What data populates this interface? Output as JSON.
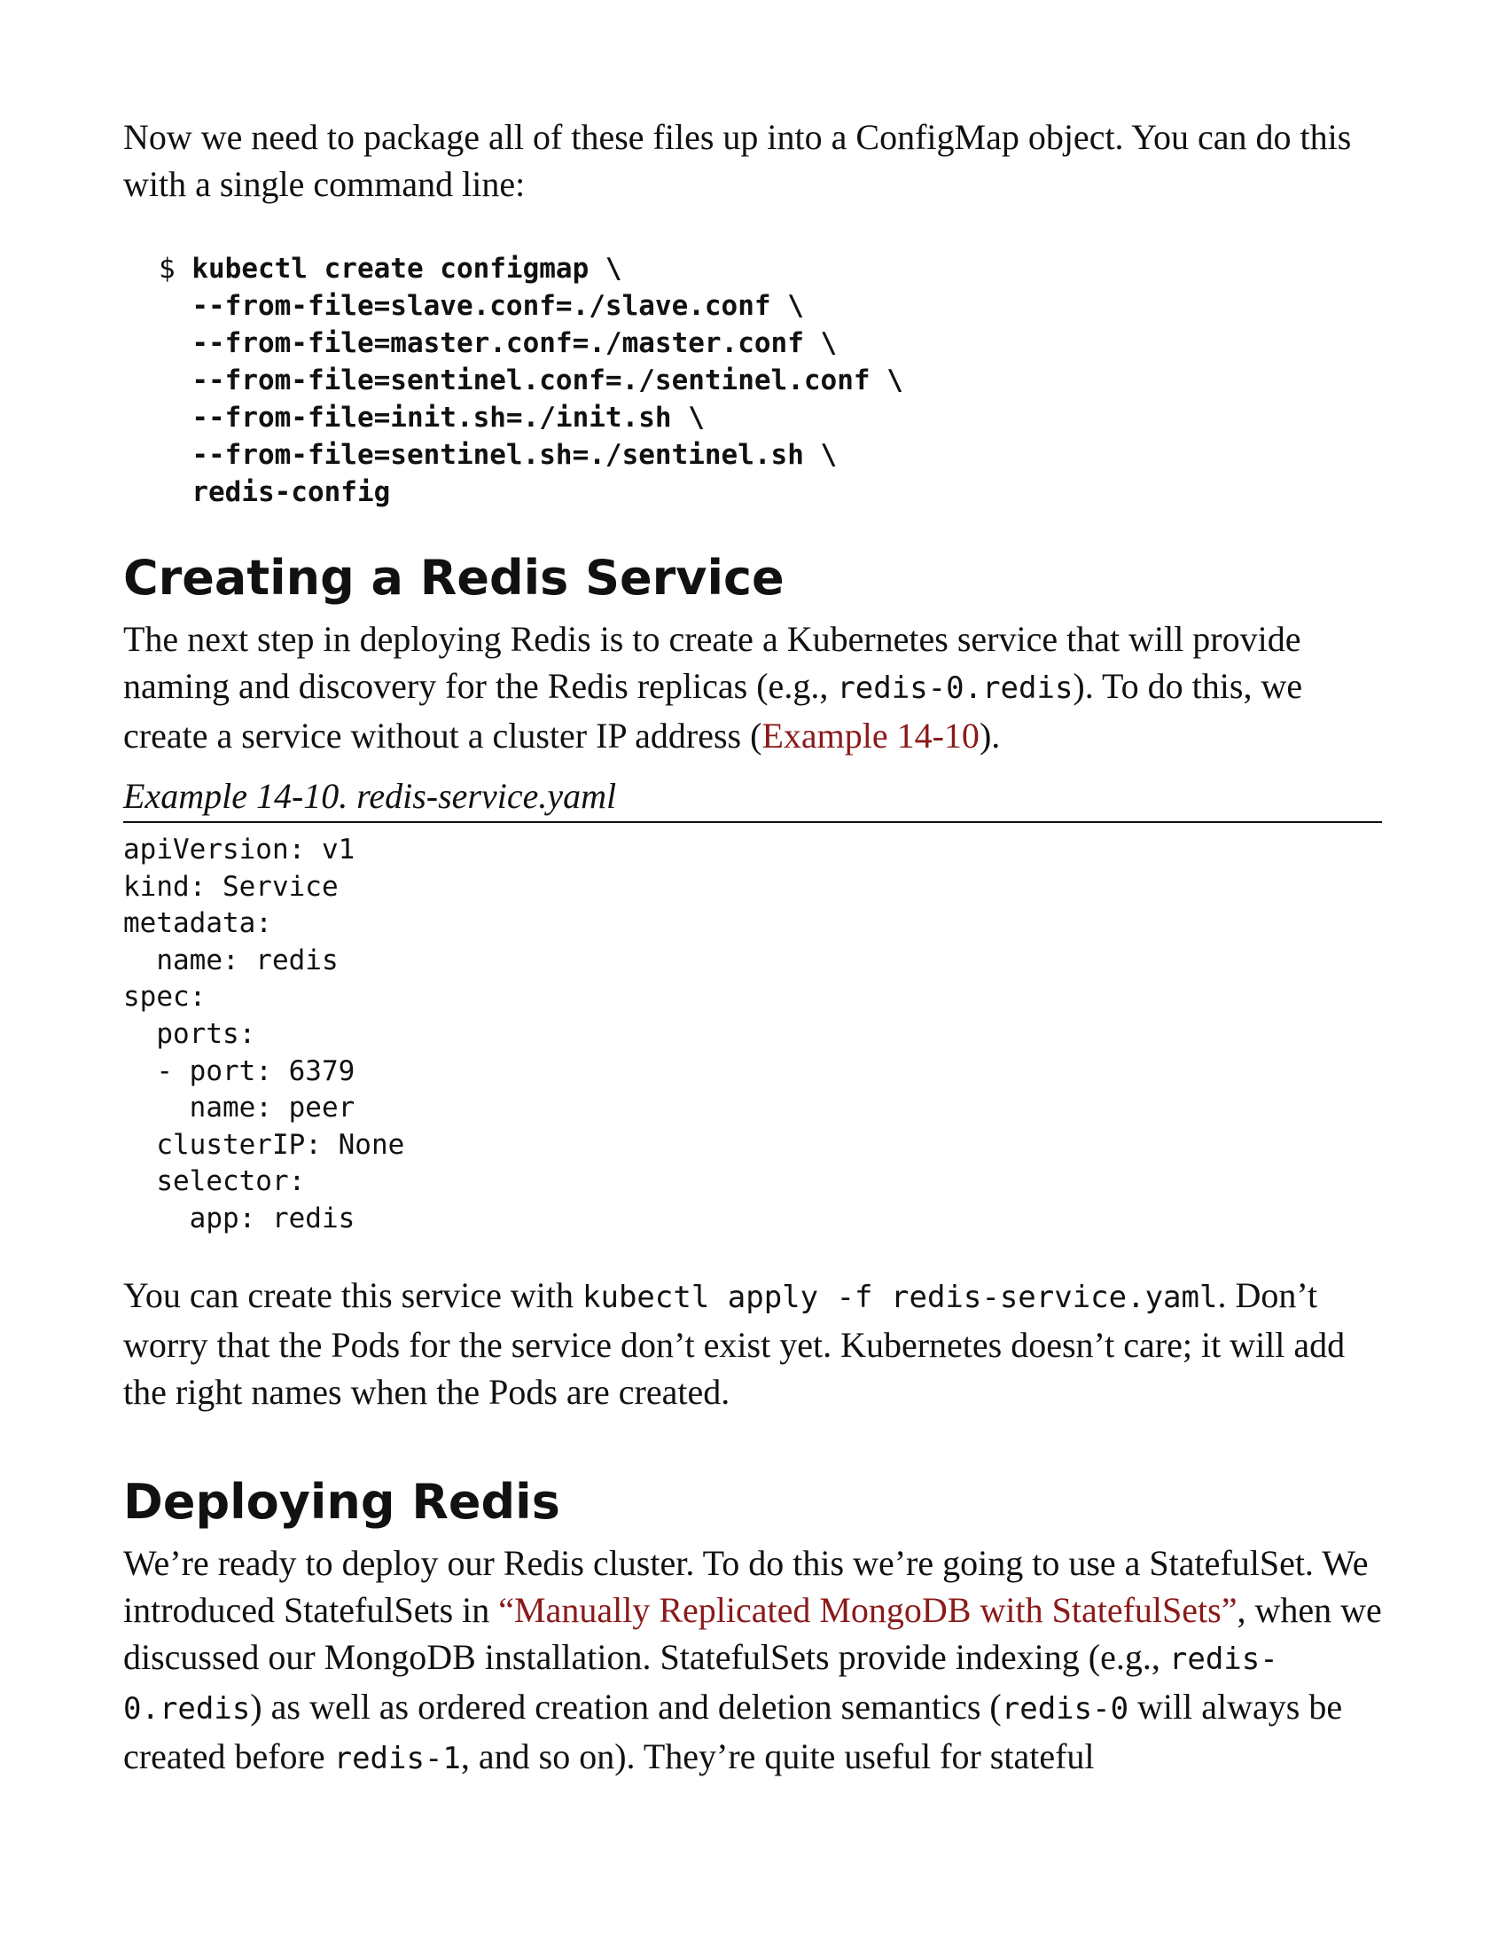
{
  "intro": {
    "text": "Now we need to package all of these files up into a ConfigMap object. You can do this with a single command line:"
  },
  "command_block": {
    "prompt": "$ ",
    "lines": [
      "kubectl create configmap \\",
      "  --from-file=slave.conf=./slave.conf \\",
      "  --from-file=master.conf=./master.conf \\",
      "  --from-file=sentinel.conf=./sentinel.conf \\",
      "  --from-file=init.sh=./init.sh \\",
      "  --from-file=sentinel.sh=./sentinel.sh \\",
      "  redis-config"
    ]
  },
  "section_service": {
    "heading": "Creating a Redis Service",
    "p1_a": "The next step in deploying Redis is to create a Kubernetes service that will provide naming and discovery for the Redis replicas (e.g., ",
    "p1_code": "redis-0.redis",
    "p1_b": "). To do this, we create a service without a cluster IP address (",
    "p1_link": "Example 14-10",
    "p1_c": ").",
    "example_caption": "Example 14-10. redis-service.yaml",
    "yaml_lines": [
      "apiVersion: v1",
      "kind: Service",
      "metadata:",
      "  name: redis",
      "spec:",
      "  ports:",
      "  - port: 6379",
      "    name: peer",
      "  clusterIP: None",
      "  selector:",
      "    app: redis"
    ],
    "p2_a": "You can create this service with ",
    "p2_code": "kubectl apply -f redis-service.yaml",
    "p2_b": ". Don’t worry that the Pods for the service don’t exist yet. Kubernetes doesn’t care; it will add the right names when the Pods are created."
  },
  "section_deploy": {
    "heading": "Deploying Redis",
    "p_a": "We’re ready to deploy our Redis cluster. To do this we’re going to use a StatefulSet. We introduced StatefulSets in ",
    "p_link": "“Manually Replicated MongoDB with StatefulSets”",
    "p_b": ", when we discussed our MongoDB installation. StatefulSets provide indexing (e.g., ",
    "p_code1": "redis-0.redis",
    "p_c": ") as well as ordered creation and deletion semantics (",
    "p_code2": "redis-0",
    "p_d": " will always be created before ",
    "p_code3": "redis-1",
    "p_e": ", and so on). They’re quite useful for stateful"
  },
  "colors": {
    "link": "#8b1a1a",
    "text": "#111111"
  }
}
